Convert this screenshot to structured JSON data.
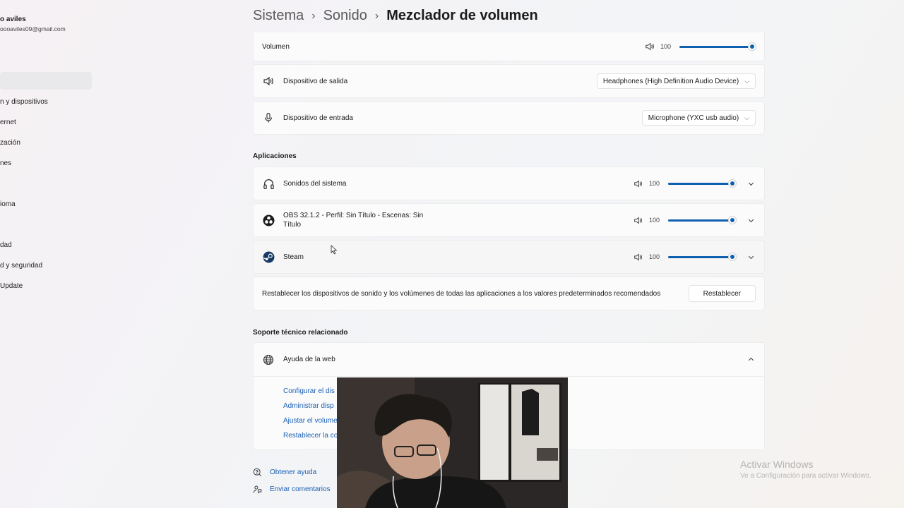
{
  "user": {
    "name": "o aviles",
    "email": "oooaviles09@gmail.com"
  },
  "sidebar": {
    "items": [
      {
        "label": "n y dispositivos"
      },
      {
        "label": "ernet"
      },
      {
        "label": "zación"
      },
      {
        "label": "nes"
      },
      {
        "label": "ioma"
      },
      {
        "label": "dad"
      },
      {
        "label": "d y seguridad"
      },
      {
        "label": "Update"
      }
    ]
  },
  "breadcrumb": {
    "level1": "Sistema",
    "level2": "Sonido",
    "current": "Mezclador de volumen",
    "separator": "›"
  },
  "volume": {
    "label": "Volumen",
    "value": "100",
    "level": 1.0
  },
  "output_device": {
    "label": "Dispositivo de salida",
    "selected": "Headphones (High Definition Audio Device)"
  },
  "input_device": {
    "label": "Dispositivo de entrada",
    "selected": "Microphone (YXC usb audio)"
  },
  "apps": {
    "title": "Aplicaciones",
    "items": [
      {
        "name": "Sonidos del sistema",
        "value": "100",
        "level": 1.0,
        "icon": "headphones-icon"
      },
      {
        "name": "OBS 32.1.2 - Perfil: Sin Título - Escenas: Sin",
        "name_line2": "Título",
        "value": "100",
        "level": 1.0,
        "icon": "obs-icon"
      },
      {
        "name": "Steam",
        "value": "100",
        "level": 1.0,
        "icon": "steam-icon"
      }
    ]
  },
  "reset": {
    "text": "Restablecer los dispositivos de sonido y los volúmenes de todas las aplicaciones a los valores predeterminados recomendados",
    "button": "Restablecer"
  },
  "support": {
    "title": "Soporte técnico relacionado",
    "web_help": "Ayuda de la web",
    "links": [
      {
        "label": "Configurar el dis"
      },
      {
        "label": "Administrar disp"
      },
      {
        "label": "Ajustar el volume"
      },
      {
        "label": "Restablecer la co"
      }
    ]
  },
  "footer": {
    "get_help": "Obtener ayuda",
    "feedback": "Enviar comentarios"
  },
  "watermark": {
    "title": "Activar Windows",
    "subtitle": "Ve a Configuración para activar Windows."
  },
  "colors": {
    "accent": "#1060b0",
    "link": "#1a5fb4"
  }
}
